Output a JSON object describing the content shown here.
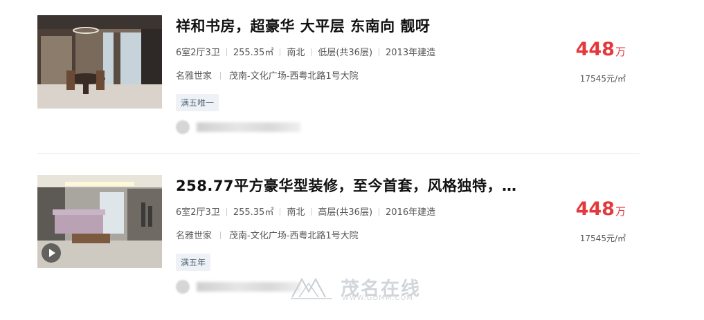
{
  "listings": [
    {
      "title": "祥和书房，超豪华 大平层 东南向 靓呀",
      "layout": "6室2厅3卫",
      "area": "255.35㎡",
      "orientation": "南北",
      "floor": "低层(共36层)",
      "built": "2013年建造",
      "community": "名雅世家",
      "location": "茂南-文化广场-西粤北路1号大院",
      "tag": "满五唯一",
      "price_num": "448",
      "price_unit": "万",
      "unit_price": "17545元/㎡",
      "has_video": false
    },
    {
      "title": "258.77平方豪华型装修，至今首套，风格独特，…",
      "layout": "6室2厅3卫",
      "area": "255.35㎡",
      "orientation": "南北",
      "floor": "高层(共36层)",
      "built": "2016年建造",
      "community": "名雅世家",
      "location": "茂南-文化广场-西粤北路1号大院",
      "tag": "满五年",
      "price_num": "448",
      "price_unit": "万",
      "unit_price": "17545元/㎡",
      "has_video": true
    }
  ],
  "watermark": {
    "text": "茂名在线",
    "url": "WWW.GDMM.COM"
  }
}
